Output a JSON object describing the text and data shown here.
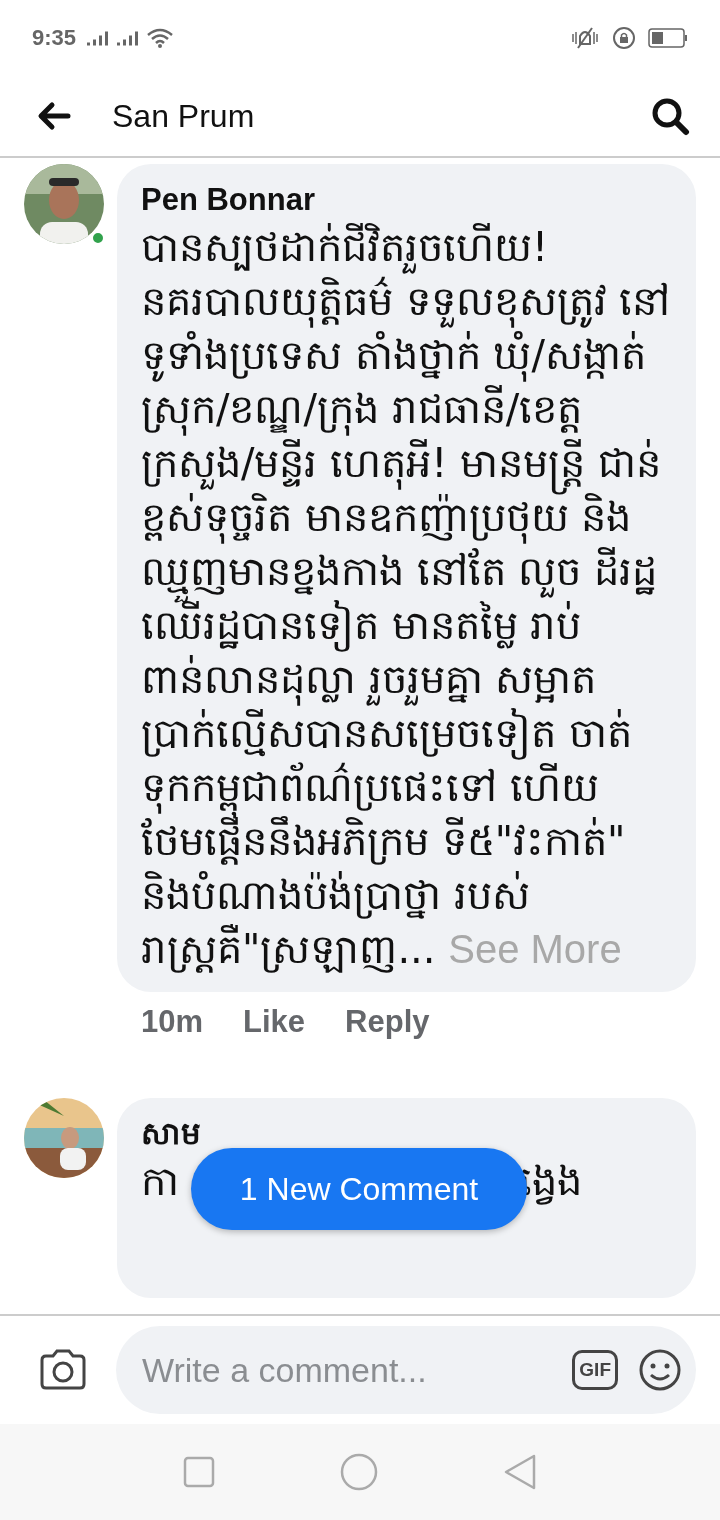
{
  "status_bar": {
    "time": "9:35"
  },
  "header": {
    "title": "San Prum"
  },
  "comments": [
    {
      "author": "Pen Bonnar",
      "online": true,
      "text": "បានស្បថដាក់ជីវិតរួចហើយ! នគរបាលយុត្តិធម៌ ទទួលខុសត្រូវ នៅ ទូទាំងប្រទេស តាំងថ្នាក់ ឃុំ/សង្កាត់ ស្រុក/ខណ្ឌ/ក្រុង រាជធានី/ខេត្ត ក្រសួង/មន្ទីរ ហេតុអី! មានមន្ត្រី ជាន់ខ្ពស់ទុច្ចរិត មានឧកញ៉ាប្រថុយ និងឈ្មួញមានខ្នងកាង នៅតែ លួច ដីរដ្ឋ ឈើរដ្ឋបានទៀត មានតម្លៃ រាប់ពាន់លានដុល្លា រួចរួមគ្នា សម្អាត ប្រាក់ល្មើសបានសម្រេចទៀត ចាត់ទុកកម្ពុជាព័ណ៌ប្រផេះទៅ ហើយ ថែមផ្តើននឹងអភិក្រម ទី៥\"វះកាត់\" និងបំណាងប៉ង់ប្រាថ្នា របស់រាស្ត្រគឺ\"ស្រឡាញ...",
      "see_more": "See More",
      "time": "10m",
      "like": "Like",
      "reply": "Reply"
    },
    {
      "author": "សាម",
      "online": false,
      "text_left": "កា",
      "text_right": "ង្វេង"
    }
  ],
  "new_comment_button": "1 New Comment",
  "composer": {
    "placeholder": "Write a comment...",
    "gif": "GIF"
  }
}
